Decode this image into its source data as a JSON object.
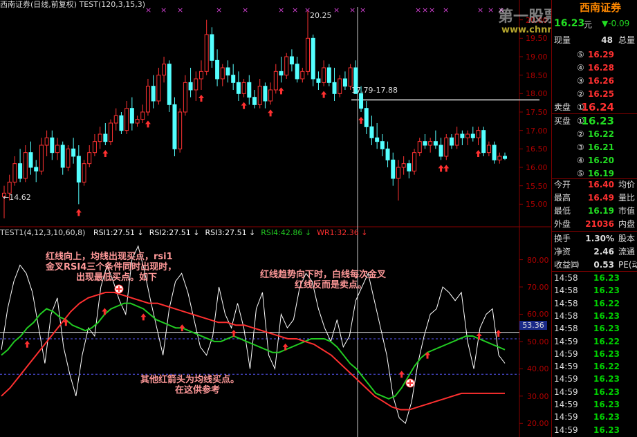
{
  "header": {
    "title": "西南证券(日线,前复权) TEST(120,3,15,3)",
    "watermark_cn": "第一股票公式网",
    "watermark_url": "www.chnmoney.com",
    "broker": "西南证券"
  },
  "indicator_bar": {
    "name": "TEST1(4,12,3,10,60,8)",
    "items": [
      {
        "label": "RSI1:27.51",
        "color": "#ffffff"
      },
      {
        "label": "RSI2:27.51",
        "color": "#ffffff"
      },
      {
        "label": "RSI3:27.51",
        "color": "#ffffff"
      },
      {
        "label": "RSI4:42.86",
        "color": "#22cc22"
      },
      {
        "label": "WR1:32.36",
        "color": "#ff3030"
      }
    ]
  },
  "annotations": {
    "a1": [
      "红线向上，均线出现买点，rsi1",
      "金叉RSI4三个条件同时出现时，",
      "出现最低买点。如下"
    ],
    "a2": [
      "红线趋势向下时，白线每次金叉",
      "红线反而是卖点。"
    ],
    "a3": [
      "其他红箭头为均线买点。",
      "在这供参考"
    ]
  },
  "chart_data": [
    {
      "type": "candlestick",
      "title": "西南证券(日线,前复权)",
      "price_axis": {
        "min": 14.5,
        "max": 20.35,
        "ticks": [
          15.0,
          15.5,
          16.0,
          16.5,
          17.0,
          17.5,
          18.0,
          18.5,
          19.0,
          19.5,
          20.0
        ]
      },
      "price_labels": [
        "15.00",
        "15.50",
        "16.00",
        "16.50",
        "17.00",
        "17.50",
        "18.00",
        "18.50",
        "19.00",
        "19.50",
        "20.00"
      ],
      "price_annotations": {
        "high": "20.25",
        "low": "←14.62",
        "crosshair": "17.79-17.88"
      },
      "crosshair_price": 17.83,
      "up_color": "#ff3232",
      "down_color": "#54ffff",
      "ohlc": [
        [
          15.2,
          15.5,
          14.62,
          15.3
        ],
        [
          15.3,
          15.8,
          15.1,
          15.6
        ],
        [
          15.6,
          16.3,
          15.5,
          16.1
        ],
        [
          16.1,
          16.5,
          15.6,
          15.7
        ],
        [
          15.7,
          16.6,
          15.6,
          16.4
        ],
        [
          16.4,
          16.7,
          15.8,
          16.0
        ],
        [
          16.0,
          16.2,
          15.6,
          15.9
        ],
        [
          15.9,
          16.8,
          15.8,
          16.6
        ],
        [
          16.6,
          17.0,
          16.3,
          16.8
        ],
        [
          16.8,
          17.0,
          16.2,
          16.4
        ],
        [
          16.4,
          16.8,
          16.2,
          16.6
        ],
        [
          16.6,
          16.7,
          15.8,
          16.0
        ],
        [
          16.0,
          16.6,
          15.9,
          16.5
        ],
        [
          16.5,
          16.8,
          16.1,
          16.3
        ],
        [
          16.3,
          16.6,
          15.0,
          15.6
        ],
        [
          15.6,
          16.2,
          15.5,
          16.1
        ],
        [
          16.1,
          16.6,
          16.0,
          16.4
        ],
        [
          16.4,
          16.9,
          16.3,
          16.7
        ],
        [
          16.7,
          17.1,
          16.5,
          16.9
        ],
        [
          16.9,
          17.2,
          16.6,
          16.7
        ],
        [
          16.7,
          17.3,
          16.6,
          17.2
        ],
        [
          17.2,
          17.6,
          17.0,
          17.4
        ],
        [
          17.4,
          17.5,
          16.9,
          17.0
        ],
        [
          17.0,
          17.8,
          16.9,
          17.6
        ],
        [
          17.6,
          17.9,
          17.0,
          17.2
        ],
        [
          17.2,
          17.4,
          17.1,
          17.3
        ],
        [
          17.3,
          17.7,
          17.2,
          17.5
        ],
        [
          17.5,
          18.4,
          17.4,
          18.2
        ],
        [
          18.2,
          18.5,
          17.6,
          17.8
        ],
        [
          17.8,
          18.7,
          17.7,
          18.5
        ],
        [
          18.5,
          19.0,
          18.3,
          18.8
        ],
        [
          18.8,
          18.9,
          17.5,
          17.7
        ],
        [
          17.7,
          17.9,
          16.3,
          16.5
        ],
        [
          16.5,
          17.6,
          16.4,
          17.5
        ],
        [
          17.5,
          18.5,
          17.4,
          18.3
        ],
        [
          18.3,
          18.7,
          17.9,
          18.1
        ],
        [
          18.1,
          18.6,
          17.8,
          18.4
        ],
        [
          18.4,
          18.9,
          18.1,
          18.6
        ],
        [
          18.6,
          20.0,
          18.5,
          19.6
        ],
        [
          19.6,
          19.8,
          18.7,
          18.9
        ],
        [
          18.9,
          19.2,
          18.2,
          18.4
        ],
        [
          18.4,
          18.8,
          18.2,
          18.7
        ],
        [
          18.7,
          18.9,
          18.3,
          18.5
        ],
        [
          18.5,
          18.8,
          18.1,
          18.3
        ],
        [
          18.3,
          18.6,
          17.8,
          18.0
        ],
        [
          18.0,
          18.4,
          17.9,
          18.3
        ],
        [
          18.3,
          18.5,
          17.7,
          17.9
        ],
        [
          17.9,
          18.1,
          17.6,
          17.7
        ],
        [
          17.7,
          18.4,
          17.6,
          18.2
        ],
        [
          18.2,
          18.3,
          17.6,
          17.8
        ],
        [
          17.8,
          18.3,
          17.7,
          18.1
        ],
        [
          18.1,
          18.8,
          18.0,
          18.6
        ],
        [
          18.6,
          19.0,
          18.3,
          18.5
        ],
        [
          18.5,
          19.1,
          18.4,
          19.0
        ],
        [
          19.0,
          19.2,
          18.6,
          18.8
        ],
        [
          18.8,
          19.0,
          18.3,
          18.4
        ],
        [
          18.4,
          18.7,
          18.3,
          18.6
        ],
        [
          18.6,
          20.25,
          18.5,
          19.5
        ],
        [
          19.5,
          19.6,
          18.2,
          18.4
        ],
        [
          18.4,
          18.6,
          18.1,
          18.3
        ],
        [
          18.3,
          18.9,
          18.2,
          18.7
        ],
        [
          18.7,
          18.8,
          18.2,
          18.3
        ],
        [
          18.3,
          18.7,
          17.8,
          18.0
        ],
        [
          18.0,
          18.5,
          17.9,
          18.4
        ],
        [
          18.4,
          18.6,
          18.1,
          18.2
        ],
        [
          18.2,
          18.8,
          18.1,
          18.7
        ],
        [
          18.7,
          18.9,
          18.0,
          18.0
        ],
        [
          18.0,
          18.2,
          17.5,
          17.6
        ],
        [
          17.6,
          17.8,
          16.9,
          17.1
        ],
        [
          17.1,
          17.4,
          16.6,
          16.8
        ],
        [
          16.8,
          17.2,
          16.5,
          16.7
        ],
        [
          16.7,
          16.9,
          16.3,
          16.5
        ],
        [
          16.5,
          16.7,
          16.0,
          16.2
        ],
        [
          16.2,
          16.4,
          15.5,
          15.7
        ],
        [
          15.7,
          16.2,
          15.1,
          16.0
        ],
        [
          16.0,
          16.3,
          15.8,
          16.1
        ],
        [
          16.1,
          16.2,
          15.7,
          15.9
        ],
        [
          15.9,
          16.5,
          15.8,
          16.4
        ],
        [
          16.4,
          16.8,
          16.3,
          16.7
        ],
        [
          16.7,
          16.9,
          16.5,
          16.6
        ],
        [
          16.6,
          16.8,
          16.4,
          16.7
        ],
        [
          16.7,
          17.0,
          16.5,
          16.6
        ],
        [
          16.6,
          16.8,
          16.2,
          16.3
        ],
        [
          16.3,
          16.9,
          16.2,
          16.8
        ],
        [
          16.8,
          16.9,
          16.5,
          16.6
        ],
        [
          16.6,
          17.1,
          16.5,
          16.9
        ],
        [
          16.9,
          17.0,
          16.6,
          16.8
        ],
        [
          16.8,
          17.0,
          16.6,
          16.9
        ],
        [
          16.9,
          17.1,
          16.7,
          16.8
        ],
        [
          16.8,
          17.1,
          16.6,
          17.0
        ],
        [
          17.0,
          17.1,
          16.3,
          16.4
        ],
        [
          16.4,
          16.7,
          16.3,
          16.6
        ],
        [
          16.6,
          16.7,
          16.1,
          16.2
        ],
        [
          16.2,
          16.4,
          16.1,
          16.3
        ],
        [
          16.3,
          16.4,
          16.2,
          16.24
        ]
      ],
      "buy_arrow_bars": [
        14,
        19,
        27,
        37,
        45,
        50,
        52,
        60,
        67,
        82,
        83,
        89
      ]
    },
    {
      "type": "line",
      "title": "TEST1(4,12,3,10,60,8)",
      "y_axis": {
        "min": 15,
        "max": 88,
        "ticks": [
          20,
          30,
          40,
          50,
          60,
          70,
          80
        ]
      },
      "y_labels": [
        "20.00",
        "30.00",
        "40.00",
        "50.00",
        "60.00",
        "70.00",
        "80.00"
      ],
      "reference_lines": {
        "white_line": 53.36,
        "dashed_upper": 51,
        "dashed_lower": 38
      },
      "reference_label": "53.36",
      "series": [
        {
          "name": "RSI1",
          "color": "#ffffff",
          "values": [
            47,
            62,
            72,
            78,
            75,
            68,
            55,
            42,
            60,
            66,
            48,
            38,
            30,
            45,
            55,
            52,
            70,
            78,
            72,
            65,
            60,
            80,
            85,
            76,
            65,
            55,
            45,
            62,
            72,
            75,
            68,
            58,
            48,
            45,
            52,
            70,
            60,
            55,
            64,
            55,
            40,
            62,
            68,
            45,
            40,
            60,
            55,
            58,
            70,
            75,
            72,
            62,
            55,
            50,
            58,
            48,
            52,
            65,
            70,
            75,
            65,
            55,
            45,
            30,
            22,
            20,
            28,
            42,
            52,
            60,
            62,
            70,
            68,
            65,
            68,
            50,
            40,
            55,
            60,
            62,
            45,
            42
          ]
        },
        {
          "name": "RSI4",
          "color": "#22cc22",
          "values": [
            45,
            47,
            50,
            52,
            55,
            57,
            60,
            62,
            61,
            59,
            58,
            56,
            55,
            54,
            55,
            57,
            60,
            62,
            63,
            64,
            64,
            63,
            62,
            60,
            58,
            57,
            56,
            55,
            55,
            54,
            53,
            52,
            51,
            50,
            50,
            51,
            52,
            51,
            50,
            49,
            48,
            47,
            46,
            46,
            47,
            48,
            49,
            50,
            51,
            51,
            51,
            50,
            48,
            45,
            42,
            40,
            37,
            34,
            31,
            30,
            29,
            30,
            33,
            37,
            41,
            44,
            46,
            47,
            48,
            49,
            50,
            51,
            52,
            52,
            51,
            50,
            49,
            48,
            47
          ]
        },
        {
          "name": "WR1",
          "color": "#ff3030",
          "values": [
            30,
            33,
            37,
            41,
            45,
            49,
            53,
            57,
            61,
            64,
            66,
            67,
            68,
            68,
            67,
            66,
            65,
            64,
            64,
            63,
            62,
            61,
            60,
            59,
            58,
            57,
            57,
            56,
            56,
            55,
            54,
            53,
            52,
            51,
            51,
            50,
            49,
            47,
            45,
            42,
            39,
            36,
            33,
            30,
            28,
            26,
            25,
            25,
            26,
            27,
            28,
            29,
            30,
            31,
            31,
            31,
            31,
            31,
            31
          ]
        }
      ]
    }
  ],
  "quote_panel": {
    "price_now": "16.23",
    "price_unit": "元",
    "change": "▼-0.09",
    "volume_label": "现量",
    "volume_value": "48",
    "total_label": "总量",
    "sell_label": "卖盘",
    "buy_label": "买盘",
    "sell_levels": [
      {
        "level": "⑤",
        "price": "16.29"
      },
      {
        "level": "④",
        "price": "16.28"
      },
      {
        "level": "③",
        "price": "16.26"
      },
      {
        "level": "②",
        "price": "16.25"
      },
      {
        "level": "①",
        "price": "16.24"
      }
    ],
    "buy_levels": [
      {
        "level": "①",
        "price": "16.23"
      },
      {
        "level": "②",
        "price": "16.22"
      },
      {
        "level": "③",
        "price": "16.21"
      },
      {
        "level": "④",
        "price": "16.20"
      },
      {
        "level": "⑤",
        "price": "16.19"
      }
    ],
    "stats": [
      {
        "label": "今开",
        "value": "16.40",
        "right": "均价",
        "color": "#ff3030"
      },
      {
        "label": "最高",
        "value": "16.49",
        "right": "量比",
        "color": "#ff3030"
      },
      {
        "label": "最低",
        "value": "16.19",
        "right": "市值",
        "color": "#22dd22"
      },
      {
        "label": "外盘",
        "value": "21036",
        "right": "内盘",
        "color": "#ff3030"
      },
      {
        "label": "换手",
        "value": "1.30%",
        "right": "股本",
        "color": "#dddddd"
      },
      {
        "label": "净资",
        "value": "2.46",
        "right": "流通",
        "color": "#dddddd"
      },
      {
        "label": "收益㈣",
        "value": "0.53",
        "right": "PE(动",
        "color": "#dddddd"
      }
    ],
    "ticks": [
      {
        "time": "14:58",
        "price": "16.23"
      },
      {
        "time": "14:58",
        "price": "16.23"
      },
      {
        "time": "14:58",
        "price": "16.22"
      },
      {
        "time": "14:58",
        "price": "16.23"
      },
      {
        "time": "14:58",
        "price": "16.23"
      },
      {
        "time": "14:59",
        "price": "16.22"
      },
      {
        "time": "14:59",
        "price": "16.23"
      },
      {
        "time": "14:59",
        "price": "16.22"
      },
      {
        "time": "14:59",
        "price": "16.23"
      },
      {
        "time": "14:59",
        "price": "16.23"
      },
      {
        "time": "14:59",
        "price": "16.23"
      },
      {
        "time": "14:59",
        "price": "16.23"
      },
      {
        "time": "14:59",
        "price": "16.23"
      }
    ]
  },
  "markers": {
    "x": "×"
  }
}
